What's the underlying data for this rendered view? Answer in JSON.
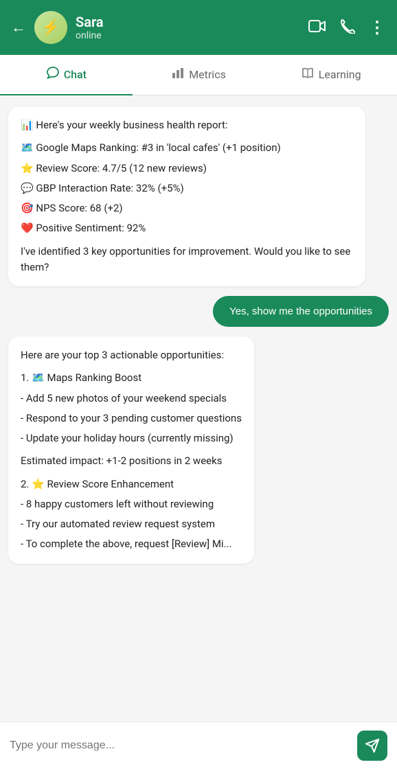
{
  "header": {
    "back_label": "←",
    "name": "Sara",
    "status": "online",
    "avatar_icon": "⚡",
    "video_icon": "📹",
    "phone_icon": "📞",
    "more_icon": "⋮"
  },
  "tabs": [
    {
      "id": "chat",
      "label": "Chat",
      "icon": "💬",
      "active": true
    },
    {
      "id": "metrics",
      "label": "Metrics",
      "icon": "📊",
      "active": false
    },
    {
      "id": "learning",
      "label": "Learning",
      "icon": "📖",
      "active": false
    }
  ],
  "messages": [
    {
      "id": "msg1",
      "type": "bot",
      "text": "📊 Here's your weekly business health report:\n\n🗺️ Google Maps Ranking: #3 in 'local cafes' (+1 position)\n⭐ Review Score: 4.7/5 (12 new reviews)\n💬 GBP Interaction Rate: 32% (+5%)\n🎯 NPS Score: 68 (+2)\n❤️ Positive Sentiment: 92%\n\nI've identified 3 key opportunities for improvement. Would you like to see them?"
    },
    {
      "id": "msg2",
      "type": "user-button",
      "text": "Yes, show me the opportunities"
    },
    {
      "id": "msg3",
      "type": "bot",
      "text": "Here are your top 3 actionable opportunities:\n\n1. 🗺️ Maps Ranking Boost\n- Add 5 new photos of your weekend specials\n- Respond to your 3 pending customer questions\n- Update your holiday hours (currently missing)\n\nEstimated impact: +1-2 positions in 2 weeks\n\n2. ⭐ Review Score Enhancement\n- 8 happy customers left without reviewing\n- Try our automated review request system\n- To complete the above, request [Review] Mi..."
    }
  ],
  "input": {
    "placeholder": "Type your message..."
  }
}
